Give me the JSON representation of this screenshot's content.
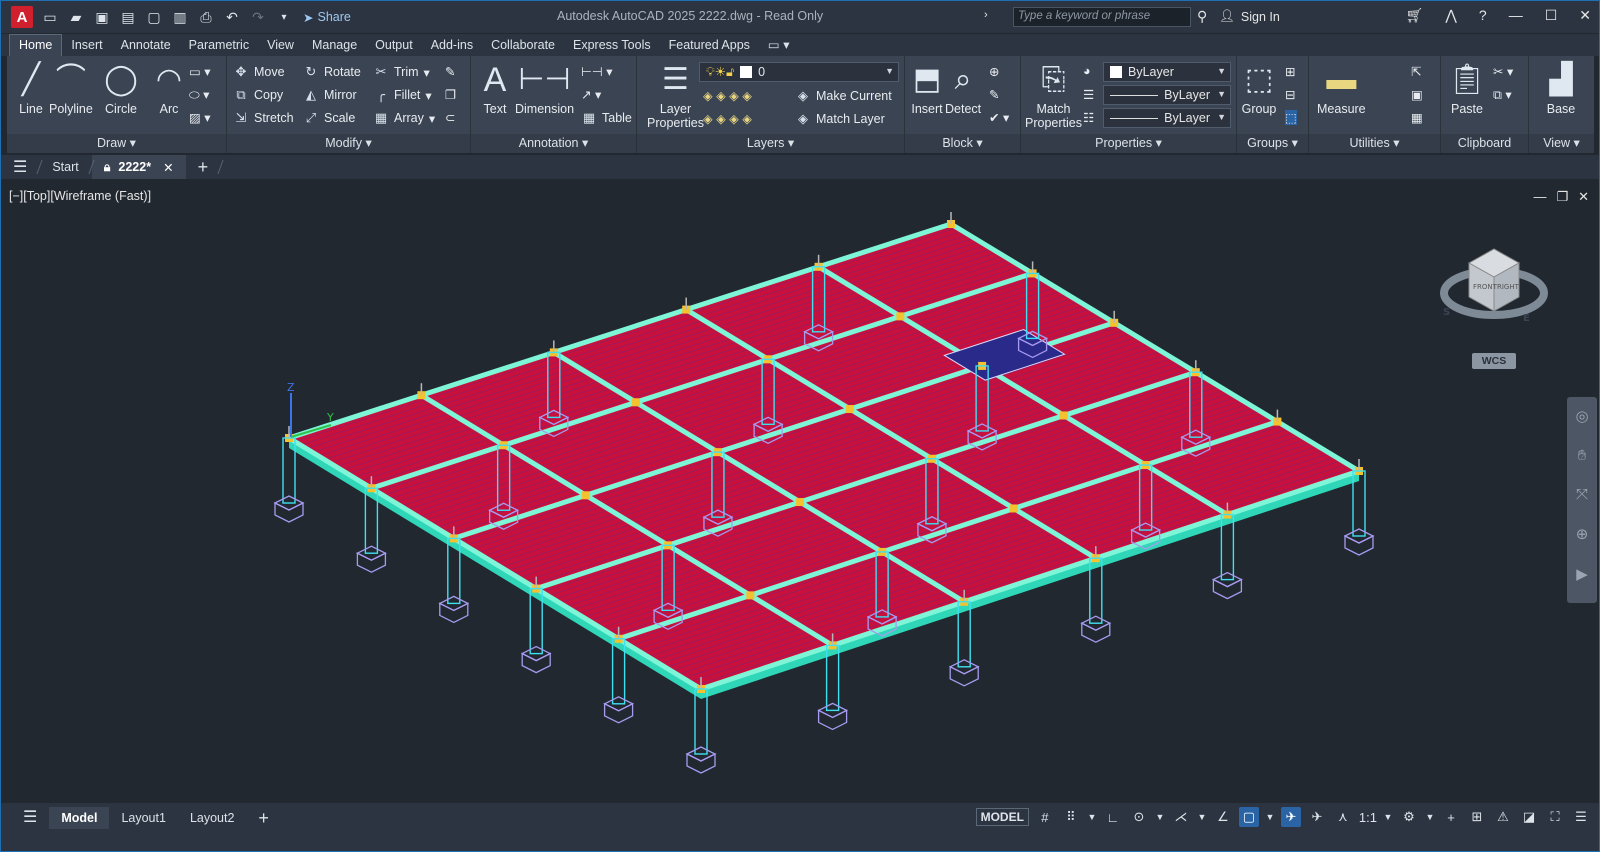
{
  "app": {
    "logo_letter": "A",
    "window_title": "Autodesk AutoCAD 2025    2222.dwg - Read Only",
    "share_label": "Share",
    "search_placeholder": "Type a keyword or phrase",
    "sign_in": "Sign In"
  },
  "ribbon_tabs": [
    "Home",
    "Insert",
    "Annotate",
    "Parametric",
    "View",
    "Manage",
    "Output",
    "Add-ins",
    "Collaborate",
    "Express Tools",
    "Featured Apps"
  ],
  "draw": {
    "title": "Draw",
    "line": "Line",
    "polyline": "Polyline",
    "circle": "Circle",
    "arc": "Arc"
  },
  "modify": {
    "title": "Modify",
    "move": "Move",
    "rotate": "Rotate",
    "trim": "Trim",
    "copy": "Copy",
    "mirror": "Mirror",
    "fillet": "Fillet",
    "stretch": "Stretch",
    "scale": "Scale",
    "array": "Array"
  },
  "annotation": {
    "title": "Annotation",
    "text": "Text",
    "dimension": "Dimension",
    "table": "Table"
  },
  "layers": {
    "title": "Layers",
    "layer_properties_1": "Layer",
    "layer_properties_2": "Properties",
    "current_layer": "0",
    "make_current": "Make Current",
    "match_layer": "Match Layer"
  },
  "block": {
    "title": "Block",
    "insert": "Insert",
    "detect": "Detect"
  },
  "properties": {
    "title": "Properties",
    "match_1": "Match",
    "match_2": "Properties",
    "color": "ByLayer",
    "lineweight": "ByLayer",
    "linetype": "ByLayer"
  },
  "groups": {
    "title": "Groups",
    "group": "Group"
  },
  "utilities": {
    "title": "Utilities",
    "measure": "Measure"
  },
  "clipboard": {
    "title": "Clipboard",
    "paste": "Paste"
  },
  "view_panel": {
    "title": "View",
    "base": "Base"
  },
  "file_tabs": {
    "start": "Start",
    "drawing": "2222*"
  },
  "viewport": {
    "label": "[−][Top][Wireframe (Fast)]",
    "wcs": "WCS",
    "cube_front": "FRONT",
    "cube_right": "RIGHT",
    "compass_s": "S",
    "compass_e": "E",
    "axis_z": "Z",
    "axis_y": "Y"
  },
  "status": {
    "model_tab": "Model",
    "layout1": "Layout1",
    "layout2": "Layout2",
    "model_space": "MODEL",
    "scale": "1:1"
  },
  "colors": {
    "slab": "#c8103d",
    "grid": "#7df5d6",
    "column": "#3fe0f0",
    "footing": "#a79bf0",
    "accent": "#2a64a4"
  }
}
